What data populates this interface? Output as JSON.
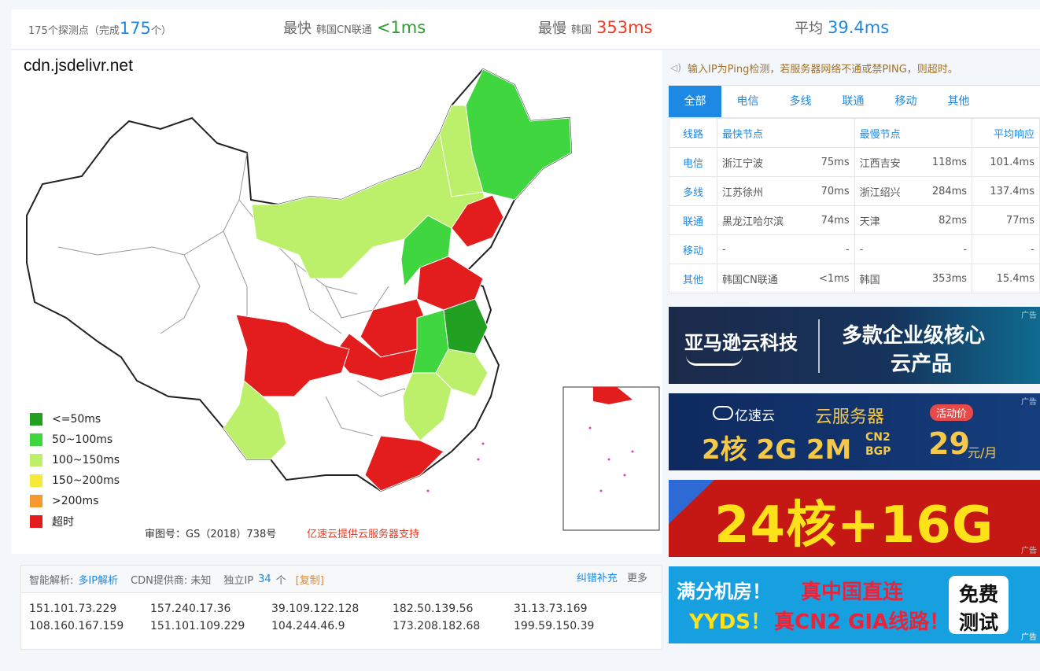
{
  "topbar": {
    "probe_prefix": "175个探测点（完成",
    "probe_done": "175",
    "probe_suffix": "个）",
    "fastest_label": "最快",
    "fastest_node": "韩国CN联通",
    "fastest_value": "<1ms",
    "slowest_label": "最慢",
    "slowest_node": "韩国",
    "slowest_value": "353ms",
    "average_label": "平均",
    "average_value": "39.4ms"
  },
  "map": {
    "site_title": "cdn.jsdelivr.net",
    "credit_left": "审图号：GS（2018）738号",
    "credit_right": "亿速云提供云服务器支持",
    "legend": [
      {
        "label": "<=50ms",
        "color": "#22a022"
      },
      {
        "label": "50~100ms",
        "color": "#3fd63f"
      },
      {
        "label": "100~150ms",
        "color": "#bdf06a"
      },
      {
        "label": "150~200ms",
        "color": "#f5e93a"
      },
      {
        "label": ">200ms",
        "color": "#f59a2f"
      },
      {
        "label": "超时",
        "color": "#e31d1d"
      }
    ]
  },
  "notice": "输入IP为Ping检测，若服务器网络不通或禁PING，则超时。",
  "tabs": [
    "全部",
    "电信",
    "多线",
    "联通",
    "移动",
    "其他"
  ],
  "results_table": {
    "headers": [
      "线路",
      "最快节点",
      "最慢节点",
      "平均响应"
    ],
    "rows": [
      {
        "line": "电信",
        "fast_node": "浙江宁波",
        "fast_ms": "75ms",
        "slow_node": "江西吉安",
        "slow_ms": "118ms",
        "avg": "101.4ms"
      },
      {
        "line": "多线",
        "fast_node": "江苏徐州",
        "fast_ms": "70ms",
        "slow_node": "浙江绍兴",
        "slow_ms": "284ms",
        "avg": "137.4ms"
      },
      {
        "line": "联通",
        "fast_node": "黑龙江哈尔滨",
        "fast_ms": "74ms",
        "slow_node": "天津",
        "slow_ms": "82ms",
        "avg": "77ms"
      },
      {
        "line": "移动",
        "fast_node": "-",
        "fast_ms": "-",
        "slow_node": "-",
        "slow_ms": "-",
        "avg": "-"
      },
      {
        "line": "其他",
        "fast_node": "韩国CN联通",
        "fast_ms": "<1ms",
        "slow_node": "韩国",
        "slow_ms": "353ms",
        "avg": "15.4ms"
      }
    ]
  },
  "ads": {
    "tag": "广告",
    "ad1": {
      "brand": "亚马逊云科技",
      "line1": "多款企业级核心",
      "line2": "云产品"
    },
    "ad2": {
      "brand": "亿速云",
      "title": "云服务器",
      "badge": "活动价",
      "spec": "2核 2G 2M",
      "cn2a": "CN2",
      "cn2b": "BGP",
      "price": "29",
      "unit": "元/月"
    },
    "ad3": {
      "text": "24核+16G"
    },
    "ad4": {
      "line1a": "满分机房！",
      "line1b": "真中国直连",
      "line2a": "YYDS！",
      "line2b": "真CN2 GIA线路！",
      "btn1": "免费",
      "btn2": "测试"
    }
  },
  "ip_panel": {
    "smart_label": "智能解析:",
    "smart_link": "多IP解析",
    "cdn_label": "CDN提供商: 未知",
    "ip_label": "独立IP",
    "ip_count": "34",
    "ip_unit": "个",
    "copy": "[复制]",
    "feedback": "纠错补充",
    "more": "更多",
    "ips": [
      "151.101.73.229",
      "157.240.17.36",
      "39.109.122.128",
      "182.50.139.56",
      "31.13.73.169",
      "108.160.167.159",
      "151.101.109.229",
      "104.244.46.9",
      "173.208.182.68",
      "199.59.150.39"
    ]
  }
}
